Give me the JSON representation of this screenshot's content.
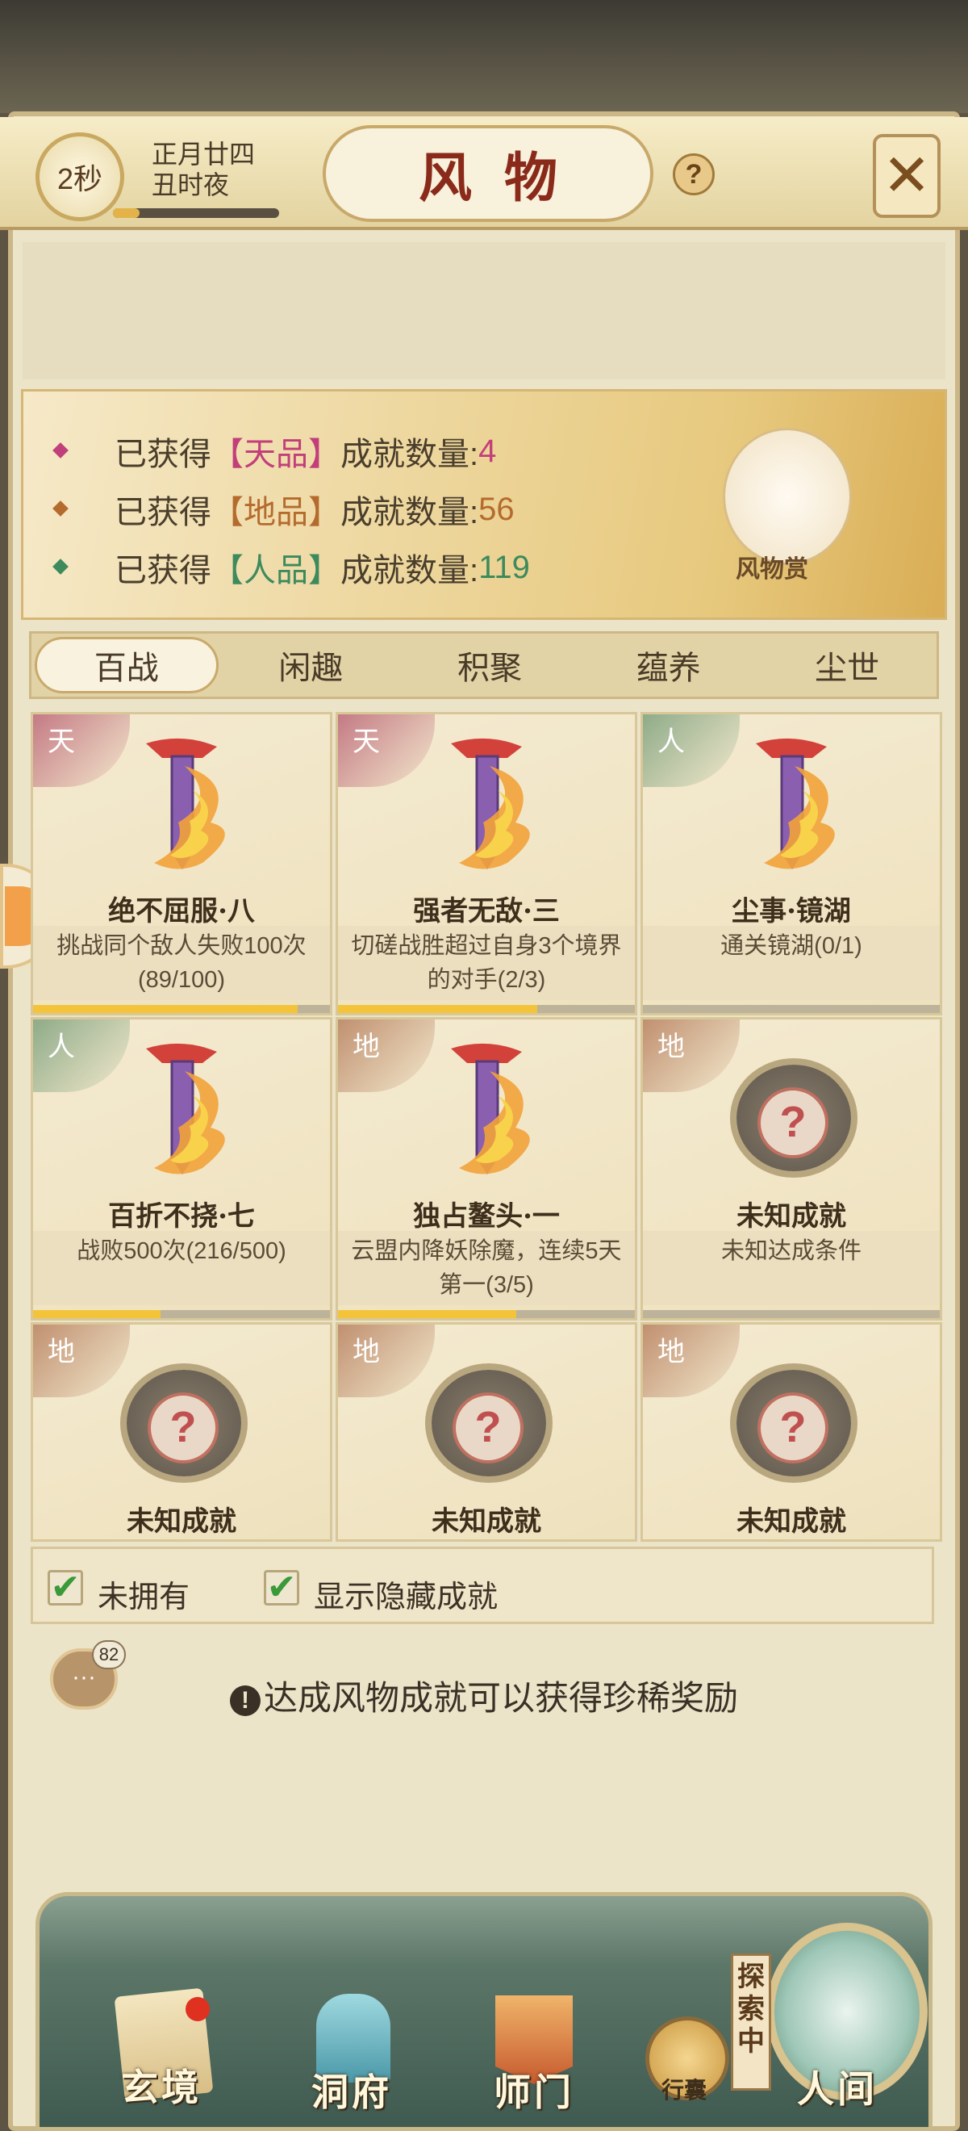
{
  "header": {
    "timer": "2秒",
    "date_line1": "正月廿四",
    "date_line2": "丑时夜",
    "timer_progress_fraction": 0.16,
    "title": "风物",
    "help_icon": "?",
    "close_icon": "crossed-swords"
  },
  "stats": {
    "rows": [
      {
        "prefix": "已获得",
        "grade": "【天品】",
        "suffix": "成就数量:",
        "count": "4",
        "color": "#c2407a"
      },
      {
        "prefix": "已获得",
        "grade": "【地品】",
        "suffix": "成就数量:",
        "count": "56",
        "color": "#b56b2e"
      },
      {
        "prefix": "已获得",
        "grade": "【人品】",
        "suffix": "成就数量:",
        "count": "119",
        "color": "#3d8a5c"
      }
    ],
    "reward_label": "风物赏"
  },
  "tabs": [
    "百战",
    "闲趣",
    "积聚",
    "蕴养",
    "尘世"
  ],
  "active_tab_index": 0,
  "cards": [
    {
      "grade": "天",
      "grade_class": "t",
      "name": "绝不屈服·八",
      "desc": "挑战同个敌人失败100次(89/100)",
      "progress": 0.89,
      "known": true
    },
    {
      "grade": "天",
      "grade_class": "t",
      "name": "强者无敌·三",
      "desc": "切磋战胜超过自身3个境界的对手(2/3)",
      "progress": 0.667,
      "known": true
    },
    {
      "grade": "人",
      "grade_class": "r",
      "name": "尘事·镜湖",
      "desc": "通关镜湖(0/1)",
      "progress": 0.0,
      "known": true
    },
    {
      "grade": "人",
      "grade_class": "r",
      "name": "百折不挠·七",
      "desc": "战败500次(216/500)",
      "progress": 0.432,
      "known": true
    },
    {
      "grade": "地",
      "grade_class": "d",
      "name": "独占鳌头·一",
      "desc": "云盟内降妖除魔，连续5天第一(3/5)",
      "progress": 0.6,
      "known": true
    },
    {
      "grade": "地",
      "grade_class": "d",
      "name": "未知成就",
      "desc": "未知达成条件",
      "progress": 0.0,
      "known": false
    },
    {
      "grade": "地",
      "grade_class": "d",
      "name": "未知成就",
      "desc": "",
      "progress": null,
      "known": false
    },
    {
      "grade": "地",
      "grade_class": "d",
      "name": "未知成就",
      "desc": "",
      "progress": null,
      "known": false
    },
    {
      "grade": "地",
      "grade_class": "d",
      "name": "未知成就",
      "desc": "",
      "progress": null,
      "known": false
    }
  ],
  "filters": [
    {
      "label": "未拥有",
      "checked": true
    },
    {
      "label": "显示隐藏成就",
      "checked": true
    }
  ],
  "chat": {
    "count": "82"
  },
  "notice": "达成风物成就可以获得珍稀奖励",
  "nav": {
    "xuanjing": "玄境",
    "dongfu": "洞府",
    "shimen": "师门",
    "xingnang": "行囊",
    "explore": "探索中",
    "renjian": "人间"
  },
  "colors": {
    "title_red": "#8a2a1a",
    "progress_gold": "#f3c43a"
  }
}
